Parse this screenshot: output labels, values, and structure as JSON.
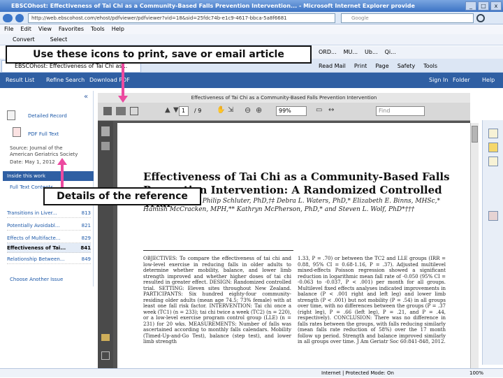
{
  "browser": {
    "title": "EBSCOhost: Effectiveness of Tai Chi as a Community-Based Falls Prevention Intervention... - Microsoft Internet Explorer provide",
    "url": "http://web.ebscohost.com/ehost/pdfviewer/pdfviewer?vid=18&sid=25fdc74b-e1c9-4617-bbca-5a8f6681",
    "search_placeholder": "Google",
    "window_controls": [
      "_",
      "□",
      "x"
    ],
    "menu": [
      "File",
      "Edit",
      "View",
      "Favorites",
      "Tools",
      "Help"
    ],
    "toolbar2": [
      "Convert",
      "Select"
    ],
    "favorites": [
      "ORD...",
      "MU...",
      "Ub...",
      "Qi..."
    ],
    "tab_label": "EBSCOhost: Effectiveness of Tai Chi as...",
    "commands": [
      "Read Mail",
      "Print",
      "Page",
      "Safety",
      "Tools"
    ],
    "status": {
      "left": "Internet | Protected Mode: On",
      "zoom": "100%"
    }
  },
  "ebsco": {
    "nav": [
      "Result List",
      "Refine Search",
      "Download PDF"
    ],
    "nav_right": [
      "Sign In",
      "Folder",
      "Help"
    ],
    "sidebar": {
      "detailed_record": "Detailed Record",
      "pdf_full_text": "PDF Full Text",
      "source": "Source: Journal of the American Geriatrics Society",
      "date": "Date: May 1, 2012",
      "inside_this_work": "Inside this work",
      "full_text_contents": "Full Text Contents",
      "issue_items": [
        {
          "title": "Transitions in Liver...",
          "page": "813"
        },
        {
          "title": "Potentially Avoidabl...",
          "page": "821"
        },
        {
          "title": "Effects of Multifacte...",
          "page": "829"
        },
        {
          "title": "Effectiveness of Tai...",
          "page": "841"
        },
        {
          "title": "Relationship Between...",
          "page": "849"
        }
      ],
      "choose_issue": "Choose Another Issue"
    }
  },
  "pdf": {
    "title_bar": "Effectiveness of Tai Chi as a Community-Based Falls Prevention Intervention",
    "page_current": "1",
    "page_total": "/ 9",
    "zoom": "99%",
    "find_placeholder": "Find",
    "article_title": "Effectiveness of Tai Chi as a Community-Based Falls Prevention Intervention: A Randomized Controlled Trial",
    "authors": "Leigh Hale, PhD,* Philip Schluter, PhD,†‡ Debra L. Waters, PhD,* Elizabeth E. Binns, MHSc,* Hamish McCracken, MPH,** Kathryn McPherson, PhD,* and Steven L. Wolf, PhD*†††",
    "abstract_left": "OBJECTIVES: To compare the effectiveness of tai chi and low-level exercise in reducing falls in older adults to determine whether mobility, balance, and lower limb strength improved and whether higher doses of tai chi resulted in greater effect. DESIGN: Randomized controlled trial. SETTING: Eleven sites throughout New Zealand. PARTICIPANTS: Six hundred eighty-four community-residing older adults (mean age 74.5; 73% female) with at least one fall risk factor. INTERVENTION: Tai chi once a week (TC1) (n = 233); tai chi twice a week (TC2) (n = 220), or a low-level exercise program control group (LLE) (n = 231) for 20 wks. MEASUREMENTS: Number of falls was ascertained according to monthly falls calendars. Mobility (Timed-Up-and-Go Test), balance (step test), and lower limb strength",
    "abstract_right": "1.33, P = .70) or between the TC2 and LLE groups (IRR = 0.88, 95% CI = 0.68-1.16, P = .37). Adjusted multilevel mixed-effects Poisson regression showed a significant reduction in logarithmic mean fall rate of -0.050 (95% CI = -0.063 to -0.037, P < .001) per month for all groups. Multilevel fixed effects analyses indicated improvements in balance (P < .001 right and left leg) and lower limb strength (P < .001) but not mobility (P = .54) in all groups over time, with no differences between the groups (P = .37 (right leg), P = .66 (left leg), P = .21, and P = .44, respectively). CONCLUSION: There was no difference in falls rates between the groups, with falls reducing similarly (mean falls rate reduction of 58%) over the 17 month follow up period. Strength and balance improved similarly in all groups over time. J Am Geriatr Soc 60:841-848, 2012."
  },
  "annotations": {
    "top": "Use these icons to print, save or email article",
    "left": "Details of the reference",
    "arrow_color": "#ec4aa0"
  }
}
